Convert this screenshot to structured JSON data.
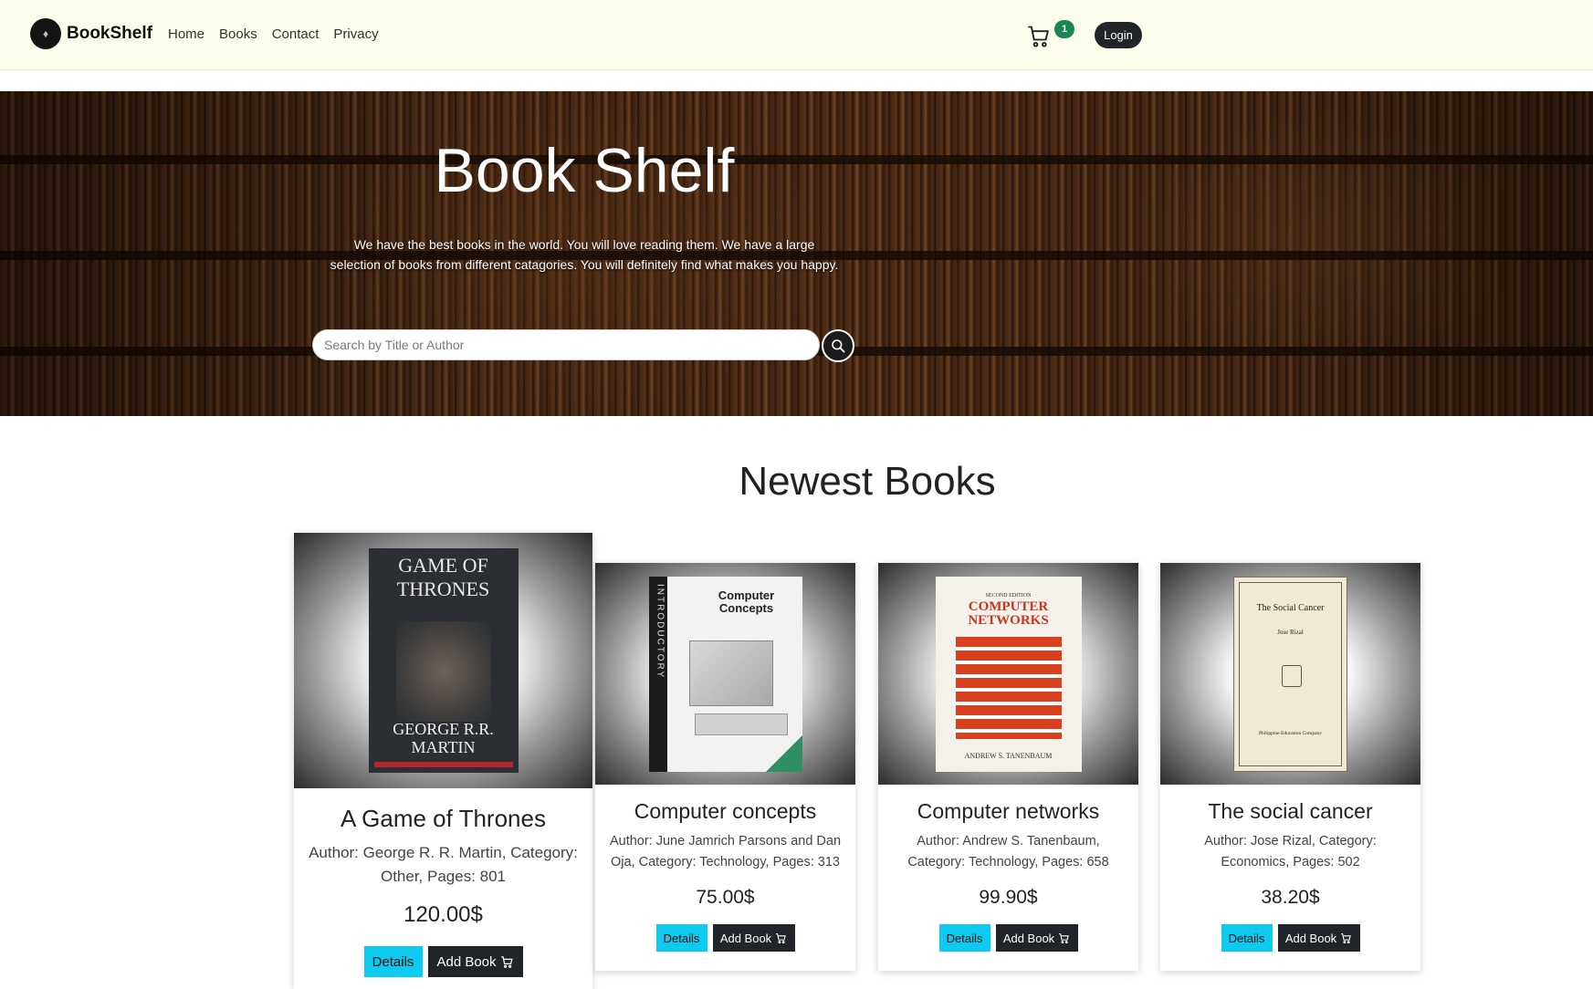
{
  "navbar": {
    "brand": "BookShelf",
    "links": [
      "Home",
      "Books",
      "Contact",
      "Privacy"
    ],
    "cart_count": "1",
    "login_label": "Login"
  },
  "hero": {
    "title": "Book Shelf",
    "description": "We have the best books in the world. You will love reading them. We have a large selection of books from different catagories. You will definitely find what makes you happy.",
    "search_placeholder": "Search by Title or Author"
  },
  "section": {
    "title": "Newest Books"
  },
  "books": [
    {
      "title": "A Game of Thrones",
      "meta": "Author: George R. R. Martin, Category: Other, Pages: 801",
      "price": "120.00$",
      "details_label": "Details",
      "add_label": "Add Book",
      "cover": {
        "top": "GAME OF THRONES",
        "bottom": "GEORGE R.R. MARTIN",
        "bg": "#2b2f33"
      }
    },
    {
      "title": "Computer concepts",
      "meta": "Author: June Jamrich Parsons and Dan Oja, Category: Technology, Pages: 313",
      "price": "75.00$",
      "details_label": "Details",
      "add_label": "Add Book",
      "cover": {
        "spine": "INTRODUCTORY",
        "top": "Computer Concepts",
        "bg": "#f2f2f2"
      }
    },
    {
      "title": "Computer networks",
      "meta": "Author: Andrew S. Tanenbaum, Category: Technology, Pages: 658",
      "price": "99.90$",
      "details_label": "Details",
      "add_label": "Add Book",
      "cover": {
        "edition": "SECOND EDITION",
        "top": "COMPUTER NETWORKS",
        "bottom": "ANDREW S. TANENBAUM",
        "bg": "#f4f1ea"
      }
    },
    {
      "title": "The social cancer",
      "meta": "Author: Jose Rizal, Category: Economics, Pages: 502",
      "price": "38.20$",
      "details_label": "Details",
      "add_label": "Add Book",
      "cover": {
        "top": "The Social Cancer",
        "author": "Jose Rizal",
        "bottom": "Philippine Education Company",
        "bg": "#efe9d6"
      }
    }
  ]
}
